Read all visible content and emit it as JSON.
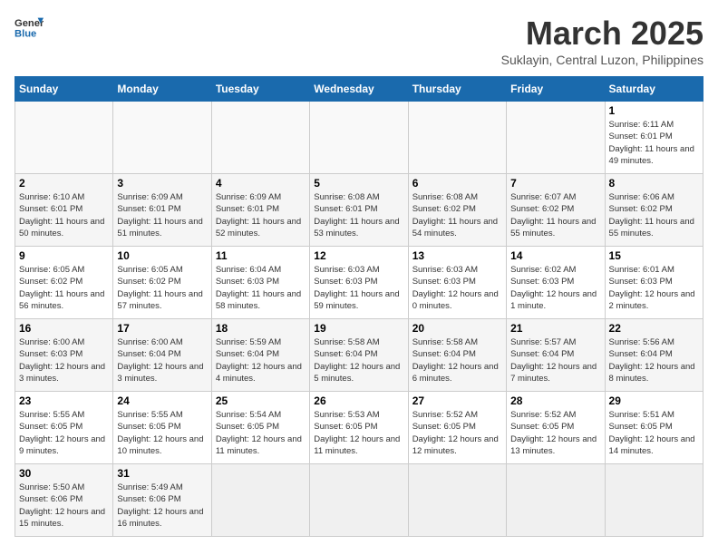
{
  "header": {
    "logo_general": "General",
    "logo_blue": "Blue",
    "month_title": "March 2025",
    "subtitle": "Suklayin, Central Luzon, Philippines"
  },
  "weekdays": [
    "Sunday",
    "Monday",
    "Tuesday",
    "Wednesday",
    "Thursday",
    "Friday",
    "Saturday"
  ],
  "weeks": [
    [
      {
        "day": "",
        "info": ""
      },
      {
        "day": "",
        "info": ""
      },
      {
        "day": "",
        "info": ""
      },
      {
        "day": "",
        "info": ""
      },
      {
        "day": "",
        "info": ""
      },
      {
        "day": "",
        "info": ""
      },
      {
        "day": "1",
        "info": "Sunrise: 6:11 AM\nSunset: 6:01 PM\nDaylight: 11 hours and 49 minutes."
      }
    ],
    [
      {
        "day": "2",
        "info": "Sunrise: 6:10 AM\nSunset: 6:01 PM\nDaylight: 11 hours and 50 minutes."
      },
      {
        "day": "3",
        "info": "Sunrise: 6:09 AM\nSunset: 6:01 PM\nDaylight: 11 hours and 51 minutes."
      },
      {
        "day": "4",
        "info": "Sunrise: 6:09 AM\nSunset: 6:01 PM\nDaylight: 11 hours and 52 minutes."
      },
      {
        "day": "5",
        "info": "Sunrise: 6:08 AM\nSunset: 6:01 PM\nDaylight: 11 hours and 53 minutes."
      },
      {
        "day": "6",
        "info": "Sunrise: 6:08 AM\nSunset: 6:02 PM\nDaylight: 11 hours and 54 minutes."
      },
      {
        "day": "7",
        "info": "Sunrise: 6:07 AM\nSunset: 6:02 PM\nDaylight: 11 hours and 55 minutes."
      },
      {
        "day": "8",
        "info": "Sunrise: 6:06 AM\nSunset: 6:02 PM\nDaylight: 11 hours and 55 minutes."
      }
    ],
    [
      {
        "day": "9",
        "info": "Sunrise: 6:05 AM\nSunset: 6:02 PM\nDaylight: 11 hours and 56 minutes."
      },
      {
        "day": "10",
        "info": "Sunrise: 6:05 AM\nSunset: 6:02 PM\nDaylight: 11 hours and 57 minutes."
      },
      {
        "day": "11",
        "info": "Sunrise: 6:04 AM\nSunset: 6:03 PM\nDaylight: 11 hours and 58 minutes."
      },
      {
        "day": "12",
        "info": "Sunrise: 6:03 AM\nSunset: 6:03 PM\nDaylight: 11 hours and 59 minutes."
      },
      {
        "day": "13",
        "info": "Sunrise: 6:03 AM\nSunset: 6:03 PM\nDaylight: 12 hours and 0 minutes."
      },
      {
        "day": "14",
        "info": "Sunrise: 6:02 AM\nSunset: 6:03 PM\nDaylight: 12 hours and 1 minute."
      },
      {
        "day": "15",
        "info": "Sunrise: 6:01 AM\nSunset: 6:03 PM\nDaylight: 12 hours and 2 minutes."
      }
    ],
    [
      {
        "day": "16",
        "info": "Sunrise: 6:00 AM\nSunset: 6:03 PM\nDaylight: 12 hours and 3 minutes."
      },
      {
        "day": "17",
        "info": "Sunrise: 6:00 AM\nSunset: 6:04 PM\nDaylight: 12 hours and 3 minutes."
      },
      {
        "day": "18",
        "info": "Sunrise: 5:59 AM\nSunset: 6:04 PM\nDaylight: 12 hours and 4 minutes."
      },
      {
        "day": "19",
        "info": "Sunrise: 5:58 AM\nSunset: 6:04 PM\nDaylight: 12 hours and 5 minutes."
      },
      {
        "day": "20",
        "info": "Sunrise: 5:58 AM\nSunset: 6:04 PM\nDaylight: 12 hours and 6 minutes."
      },
      {
        "day": "21",
        "info": "Sunrise: 5:57 AM\nSunset: 6:04 PM\nDaylight: 12 hours and 7 minutes."
      },
      {
        "day": "22",
        "info": "Sunrise: 5:56 AM\nSunset: 6:04 PM\nDaylight: 12 hours and 8 minutes."
      }
    ],
    [
      {
        "day": "23",
        "info": "Sunrise: 5:55 AM\nSunset: 6:05 PM\nDaylight: 12 hours and 9 minutes."
      },
      {
        "day": "24",
        "info": "Sunrise: 5:55 AM\nSunset: 6:05 PM\nDaylight: 12 hours and 10 minutes."
      },
      {
        "day": "25",
        "info": "Sunrise: 5:54 AM\nSunset: 6:05 PM\nDaylight: 12 hours and 11 minutes."
      },
      {
        "day": "26",
        "info": "Sunrise: 5:53 AM\nSunset: 6:05 PM\nDaylight: 12 hours and 11 minutes."
      },
      {
        "day": "27",
        "info": "Sunrise: 5:52 AM\nSunset: 6:05 PM\nDaylight: 12 hours and 12 minutes."
      },
      {
        "day": "28",
        "info": "Sunrise: 5:52 AM\nSunset: 6:05 PM\nDaylight: 12 hours and 13 minutes."
      },
      {
        "day": "29",
        "info": "Sunrise: 5:51 AM\nSunset: 6:05 PM\nDaylight: 12 hours and 14 minutes."
      }
    ],
    [
      {
        "day": "30",
        "info": "Sunrise: 5:50 AM\nSunset: 6:06 PM\nDaylight: 12 hours and 15 minutes."
      },
      {
        "day": "31",
        "info": "Sunrise: 5:49 AM\nSunset: 6:06 PM\nDaylight: 12 hours and 16 minutes."
      },
      {
        "day": "",
        "info": ""
      },
      {
        "day": "",
        "info": ""
      },
      {
        "day": "",
        "info": ""
      },
      {
        "day": "",
        "info": ""
      },
      {
        "day": "",
        "info": ""
      }
    ]
  ]
}
